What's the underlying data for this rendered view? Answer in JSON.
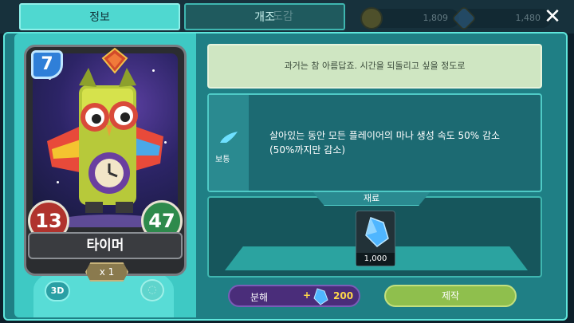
{
  "tabs": {
    "info_label": "정보",
    "remodel_label": "개조",
    "ghost_label": "도감"
  },
  "currency": {
    "gold": "1,809",
    "gems": "1,480"
  },
  "card": {
    "cost": "7",
    "name": "타이머",
    "attack": "13",
    "health": "47",
    "count": "x 1",
    "view_3d_label": "3D"
  },
  "details": {
    "flavor_text": "과거는 참 아름답죠. 시간을 되돌리고 싶을 정도로",
    "ability_tier": "보통",
    "ability_line1": "살아있는 동안 모든 플레이어의 마나 생성 속도 50% 감소",
    "ability_line2": "(50%까지만 감소)"
  },
  "materials": {
    "label": "재료",
    "quantity": "1,000"
  },
  "actions": {
    "disenchant_label": "분해",
    "disenchant_plus": "+",
    "disenchant_amount": "200",
    "craft_label": "제작"
  },
  "colors": {
    "accent": "#3ec9c4",
    "craft": "#8fbf4d",
    "disenchant": "#4a2d7a"
  }
}
